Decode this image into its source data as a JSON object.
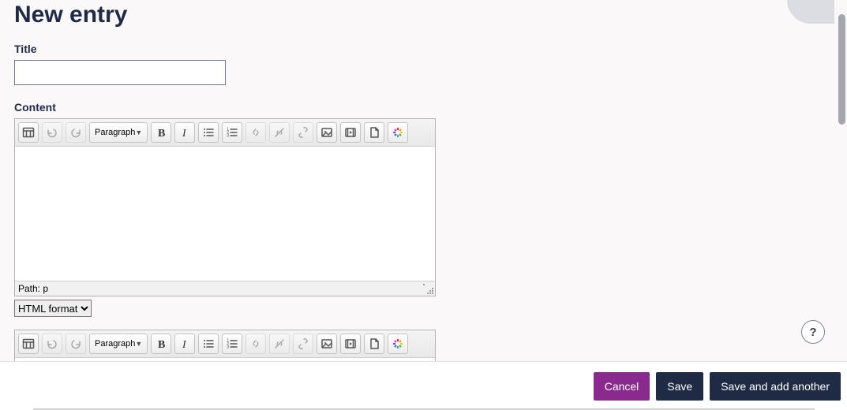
{
  "page": {
    "heading": "New entry",
    "title_label": "Title",
    "title_value": "",
    "content_label": "Content"
  },
  "editor": {
    "paragraph_label": "Paragraph",
    "status_path": "Path: p",
    "format_options": [
      "HTML format"
    ],
    "format_selected": "HTML format"
  },
  "footer": {
    "cancel": "Cancel",
    "save": "Save",
    "save_add": "Save and add another"
  },
  "help": {
    "symbol": "?"
  }
}
